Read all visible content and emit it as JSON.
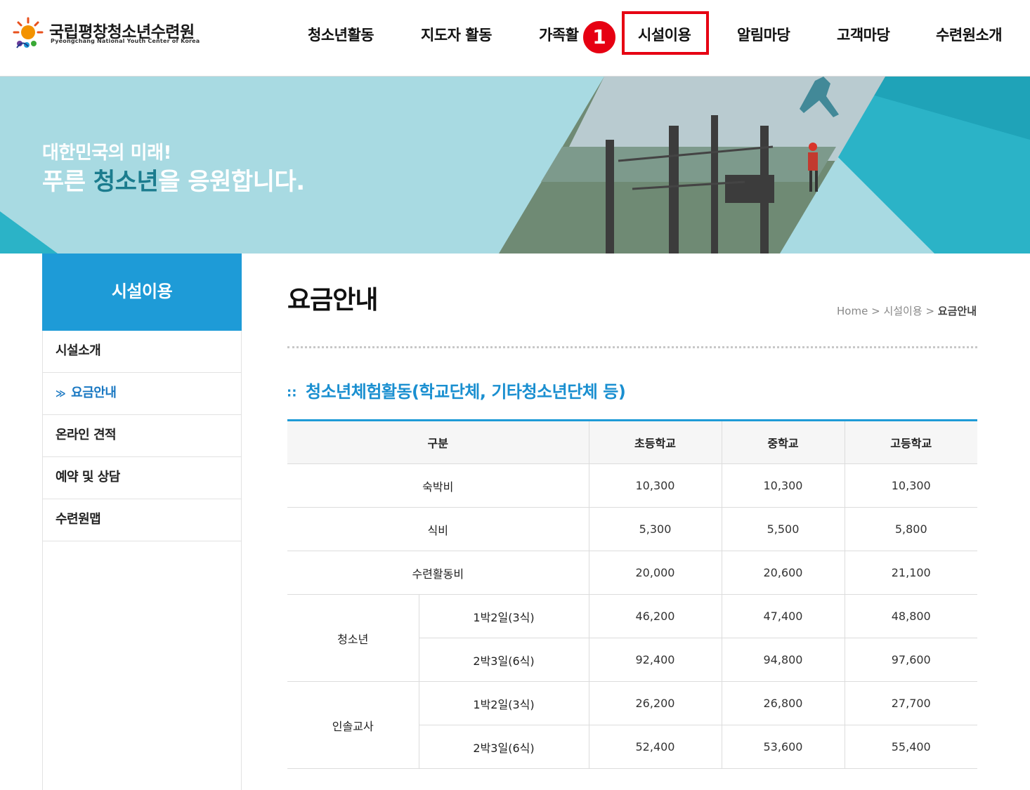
{
  "header": {
    "logo": {
      "name_kr": "국립평창청소년수련원",
      "name_en": "Pyeongchang National Youth Center of Korea"
    },
    "nav": [
      "청소년활동",
      "지도자 활동",
      "가족활",
      "시설이용",
      "알림마당",
      "고객마당",
      "수련원소개"
    ],
    "step_marker": "1"
  },
  "banner": {
    "line1": "대한민국의 미래!",
    "line2_a": "푸른 ",
    "line2_b": "청소년",
    "line2_c": "을 응원합니다."
  },
  "sidebar": {
    "title": "시설이용",
    "items": [
      "시설소개",
      "요금안내",
      "온라인 견적",
      "예약 및 상담",
      "수련원맵"
    ],
    "active_index": 1
  },
  "content": {
    "title": "요금안내",
    "breadcrumb": {
      "home": "Home",
      "sep": ">",
      "parent": "시설이용",
      "current": "요금안내"
    },
    "section_title": "청소년체험활동(학교단체, 기타청소년단체 등)",
    "table": {
      "headers": [
        "구분",
        "초등학교",
        "중학교",
        "고등학교"
      ],
      "rows": {
        "lodging": {
          "label": "숙박비",
          "values": [
            "10,300",
            "10,300",
            "10,300"
          ]
        },
        "meal": {
          "label": "식비",
          "values": [
            "5,300",
            "5,500",
            "5,800"
          ]
        },
        "activity": {
          "label": "수련활동비",
          "values": [
            "20,000",
            "20,600",
            "21,100"
          ]
        }
      },
      "groups": [
        {
          "label": "청소년",
          "rows": [
            {
              "label": "1박2일(3식)",
              "values": [
                "46,200",
                "47,400",
                "48,800"
              ]
            },
            {
              "label": "2박3일(6식)",
              "values": [
                "92,400",
                "94,800",
                "97,600"
              ]
            }
          ]
        },
        {
          "label": "인솔교사",
          "rows": [
            {
              "label": "1박2일(3식)",
              "values": [
                "26,200",
                "26,800",
                "27,700"
              ]
            },
            {
              "label": "2박3일(6식)",
              "values": [
                "52,400",
                "53,600",
                "55,400"
              ]
            }
          ]
        }
      ]
    }
  },
  "colors": {
    "primary_blue": "#1e9bd7",
    "highlight_red": "#e60012",
    "banner_bg": "#a8dae2",
    "banner_accent": "#2bb3c7"
  }
}
